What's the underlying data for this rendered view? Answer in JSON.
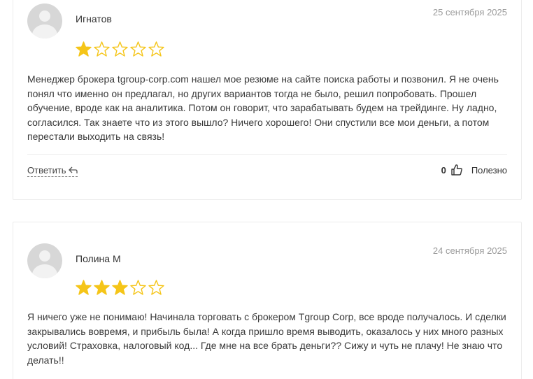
{
  "reviews": [
    {
      "author": "Игнатов",
      "date": "25 сентября 2025",
      "rating": 1,
      "max_rating": 5,
      "text": "Менеджер брокера tgroup-corp.com нашел мое резюме на сайте поиска работы и позвонил. Я не очень понял что именно он предлагал, но других вариантов тогда не было, решил попробовать. Прошел обучение, вроде как на аналитика. Потом он говорит, что зарабатывать будем на трейдинге. Ну ладно, согласился. Так знаете что из этого вышло? Ничего хорошего! Они спустили все мои деньги, а потом перестали выходить на связь!",
      "reply_label": "Ответить",
      "likes": "0",
      "useful_label": "Полезно"
    },
    {
      "author": "Полина М",
      "date": "24 сентября 2025",
      "rating": 3,
      "max_rating": 5,
      "text": "Я ничего уже не понимаю! Начинала торговать с брокером Tgroup Corp, все вроде получалось. И сделки закрывались вовремя, и прибыль была! А когда пришло время выводить, оказалось у них много разных условий! Страховка, налоговый код... Где мне на все брать деньги?? Сижу и чуть не плачу! Не знаю что делать!!"
    }
  ],
  "colors": {
    "star_filled": "#f5c518",
    "star_outline": "#f5c518",
    "date": "#9a9a9a"
  }
}
